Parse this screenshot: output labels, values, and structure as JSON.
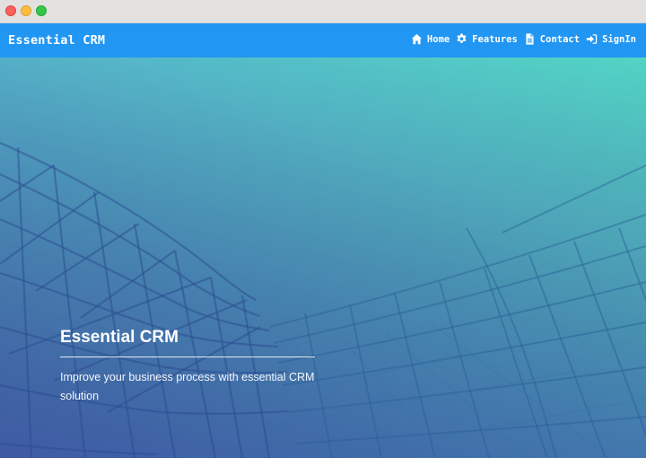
{
  "window": {
    "controls": [
      "close",
      "minimize",
      "maximize"
    ]
  },
  "navbar": {
    "brand": "Essential CRM",
    "items": [
      {
        "label": "Home",
        "icon": "home-icon"
      },
      {
        "label": "Features",
        "icon": "gear-icon"
      },
      {
        "label": "Contact",
        "icon": "document-icon"
      },
      {
        "label": "SignIn",
        "icon": "sign-in-icon"
      }
    ]
  },
  "hero": {
    "title": "Essential CRM",
    "subtitle": "Improve your business process with essential CRM solution"
  },
  "colors": {
    "navbar": "#2196f3",
    "hero_gradient_top": "#52d4c5",
    "hero_gradient_bottom": "#4a68b3",
    "text": "#ffffff"
  }
}
